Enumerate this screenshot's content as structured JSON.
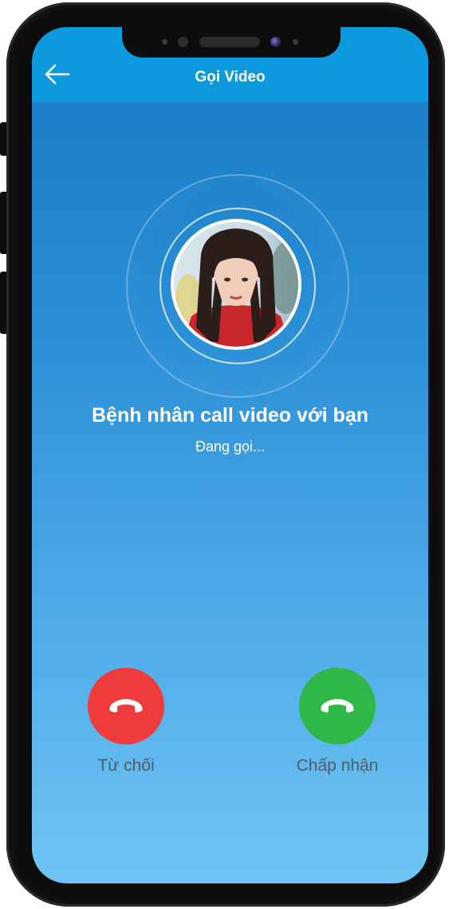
{
  "header": {
    "title": "Gọi Video",
    "back_icon": "arrow-left-icon"
  },
  "caller": {
    "title": "Bệnh nhân call video với bạn",
    "status": "Đang gọi..."
  },
  "actions": {
    "decline_label": "Từ chối",
    "decline_icon": "phone-hangup-icon",
    "accept_label": "Chấp nhận",
    "accept_icon": "phone-hangup-icon"
  },
  "colors": {
    "header_bg": "#0d99dd",
    "decline": "#ef3b3b",
    "accept": "#2fb848"
  }
}
